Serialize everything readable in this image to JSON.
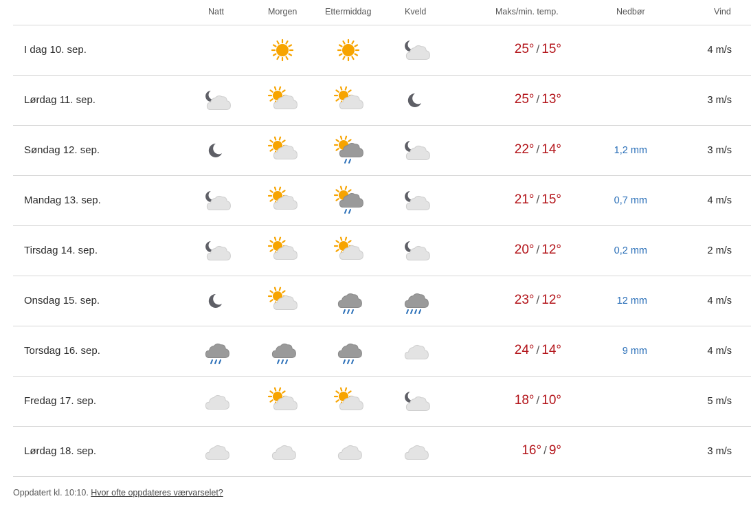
{
  "headers": {
    "natt": "Natt",
    "morgen": "Morgen",
    "ettermiddag": "Ettermiddag",
    "kveld": "Kveld",
    "temp": "Maks/min. temp.",
    "precip": "Nedbør",
    "wind": "Vind"
  },
  "colors": {
    "temp": "#b3141a",
    "precip": "#2a6fb8",
    "sun": "#f7a400",
    "moon": "#5e5f66",
    "cloud_light": "#e3e3e3",
    "cloud_dark": "#9a9a9a",
    "rain": "#2a6fb8"
  },
  "days": [
    {
      "label": "I dag 10. sep.",
      "icons": [
        "",
        "sun-icon",
        "sun-icon",
        "moon-cloud-icon"
      ],
      "max": "25°",
      "min": "15°",
      "precip": "",
      "wind": "4 m/s"
    },
    {
      "label": "Lørdag 11. sep.",
      "icons": [
        "moon-cloud-icon",
        "sun-cloud-icon",
        "sun-cloud-icon",
        "moon-icon"
      ],
      "max": "25°",
      "min": "13°",
      "precip": "",
      "wind": "3 m/s"
    },
    {
      "label": "Søndag 12. sep.",
      "icons": [
        "moon-icon",
        "sun-cloud-icon",
        "sun-rain-icon",
        "moon-cloud-icon"
      ],
      "max": "22°",
      "min": "14°",
      "precip": "1,2 mm",
      "wind": "3 m/s"
    },
    {
      "label": "Mandag 13. sep.",
      "icons": [
        "moon-cloud-icon",
        "sun-cloud-icon",
        "sun-rain-icon",
        "moon-cloud-icon"
      ],
      "max": "21°",
      "min": "15°",
      "precip": "0,7 mm",
      "wind": "4 m/s"
    },
    {
      "label": "Tirsdag 14. sep.",
      "icons": [
        "moon-cloud-icon",
        "sun-cloud-icon",
        "sun-cloud-icon",
        "moon-cloud-icon"
      ],
      "max": "20°",
      "min": "12°",
      "precip": "0,2 mm",
      "wind": "2 m/s"
    },
    {
      "label": "Onsdag 15. sep.",
      "icons": [
        "moon-icon",
        "sun-cloud-icon",
        "rain-cloud-icon",
        "heavy-rain-icon"
      ],
      "max": "23°",
      "min": "12°",
      "precip": "12 mm",
      "wind": "4 m/s"
    },
    {
      "label": "Torsdag 16. sep.",
      "icons": [
        "rain-cloud-icon",
        "rain-cloud-icon",
        "rain-cloud-icon",
        "cloud-icon"
      ],
      "max": "24°",
      "min": "14°",
      "precip": "9 mm",
      "wind": "4 m/s"
    },
    {
      "label": "Fredag 17. sep.",
      "icons": [
        "cloud-icon",
        "sun-cloud-icon",
        "sun-cloud-icon",
        "moon-cloud-icon"
      ],
      "max": "18°",
      "min": "10°",
      "precip": "",
      "wind": "5 m/s"
    },
    {
      "label": "Lørdag 18. sep.",
      "icons": [
        "cloud-icon",
        "cloud-icon",
        "cloud-icon",
        "cloud-icon"
      ],
      "max": "16°",
      "min": "9°",
      "precip": "",
      "wind": "3 m/s"
    }
  ],
  "footer": {
    "updated": "Oppdatert kl. 10:10.",
    "link": "Hvor ofte oppdateres værvarselet?"
  }
}
